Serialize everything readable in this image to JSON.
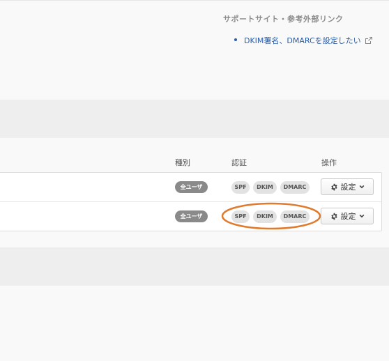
{
  "support": {
    "title": "サポートサイト・参考外部リンク",
    "links": [
      {
        "label": "DKIM署名、DMARCを設定したい",
        "icon": "external-link-icon"
      }
    ]
  },
  "table": {
    "headers": {
      "type": "種別",
      "auth": "認証",
      "ops": "操作"
    },
    "rows": [
      {
        "user_badge": "全ユーザ",
        "auth_tags": [
          "SPF",
          "DKIM",
          "DMARC"
        ],
        "settings_label": "設定"
      },
      {
        "user_badge": "全ユーザ",
        "auth_tags": [
          "SPF",
          "DKIM",
          "DMARC"
        ],
        "settings_label": "設定"
      }
    ]
  },
  "icons": {
    "settings": "gear-icon",
    "dropdown": "chevron-down-icon",
    "external": "external-link-icon"
  },
  "colors": {
    "link": "#2a5ea8",
    "badge_bg": "#8a8a8a",
    "tag_bg": "#e2e2e2",
    "highlight": "#e07a2c"
  }
}
